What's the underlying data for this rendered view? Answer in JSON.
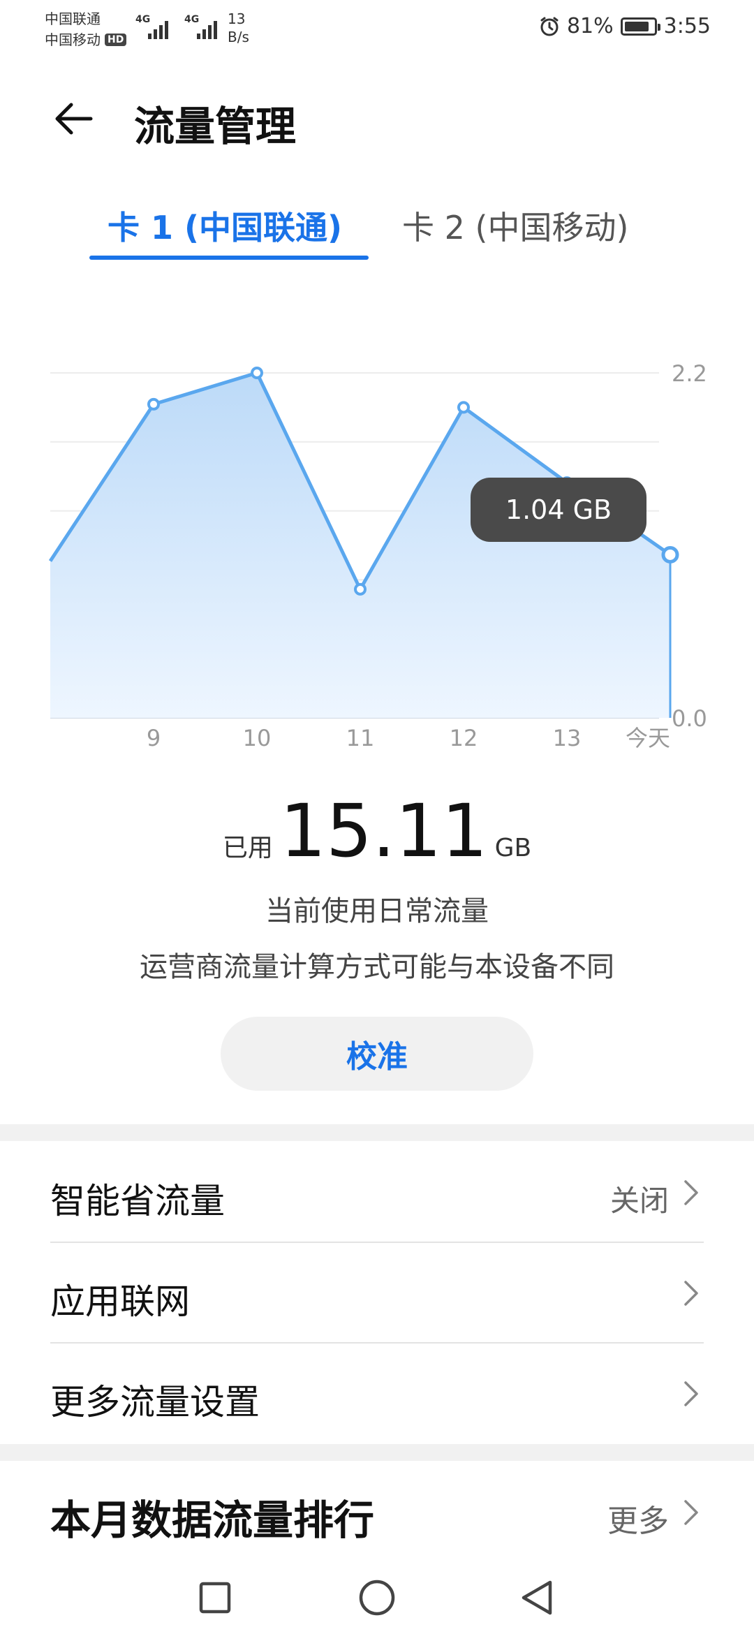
{
  "status_bar": {
    "carrier1": "中国联通",
    "carrier2": "中国移动",
    "hd_badge": "HD",
    "network1": "4G",
    "network2": "4G",
    "speed_value": "13",
    "speed_unit": "B/s",
    "battery": "81%",
    "time": "3:55",
    "battery_level": 0.81
  },
  "header": {
    "title": "流量管理",
    "back_icon": "arrow-left-icon"
  },
  "tabs": [
    {
      "label": "卡 1 (中国联通)",
      "selected": true
    },
    {
      "label": "卡 2 (中国移动)",
      "selected": false
    }
  ],
  "chart_data": {
    "type": "area",
    "x": [
      "",
      "9",
      "10",
      "11",
      "12",
      "13",
      "今天"
    ],
    "values": [
      1.0,
      2.0,
      2.2,
      0.82,
      1.98,
      1.5,
      1.04
    ],
    "ylim": [
      0.0,
      2.2
    ],
    "yticks": [
      "2.2",
      "0.0"
    ],
    "grid": true,
    "tooltip": "1.04 GB",
    "colors": {
      "line": "#5aa7ee",
      "fill_top": "#bcdaf8",
      "fill_bottom": "#eef6ff"
    }
  },
  "usage": {
    "prefix": "已用",
    "value": "15.11",
    "unit": "GB",
    "line1": "当前使用日常流量",
    "line2": "运营商流量计算方式可能与本设备不同",
    "calibrate": "校准"
  },
  "settings": [
    {
      "label": "智能省流量",
      "value": "关闭"
    },
    {
      "label": "应用联网",
      "value": ""
    },
    {
      "label": "更多流量设置",
      "value": ""
    }
  ],
  "ranking": {
    "title": "本月数据流量排行",
    "more": "更多"
  },
  "navbar": {
    "icons": [
      "square-icon",
      "circle-icon",
      "triangle-back-icon"
    ]
  },
  "colors": {
    "accent": "#1a73e8",
    "tooltip_bg": "#4a4a4a",
    "section_bg": "#f1f1f1"
  }
}
